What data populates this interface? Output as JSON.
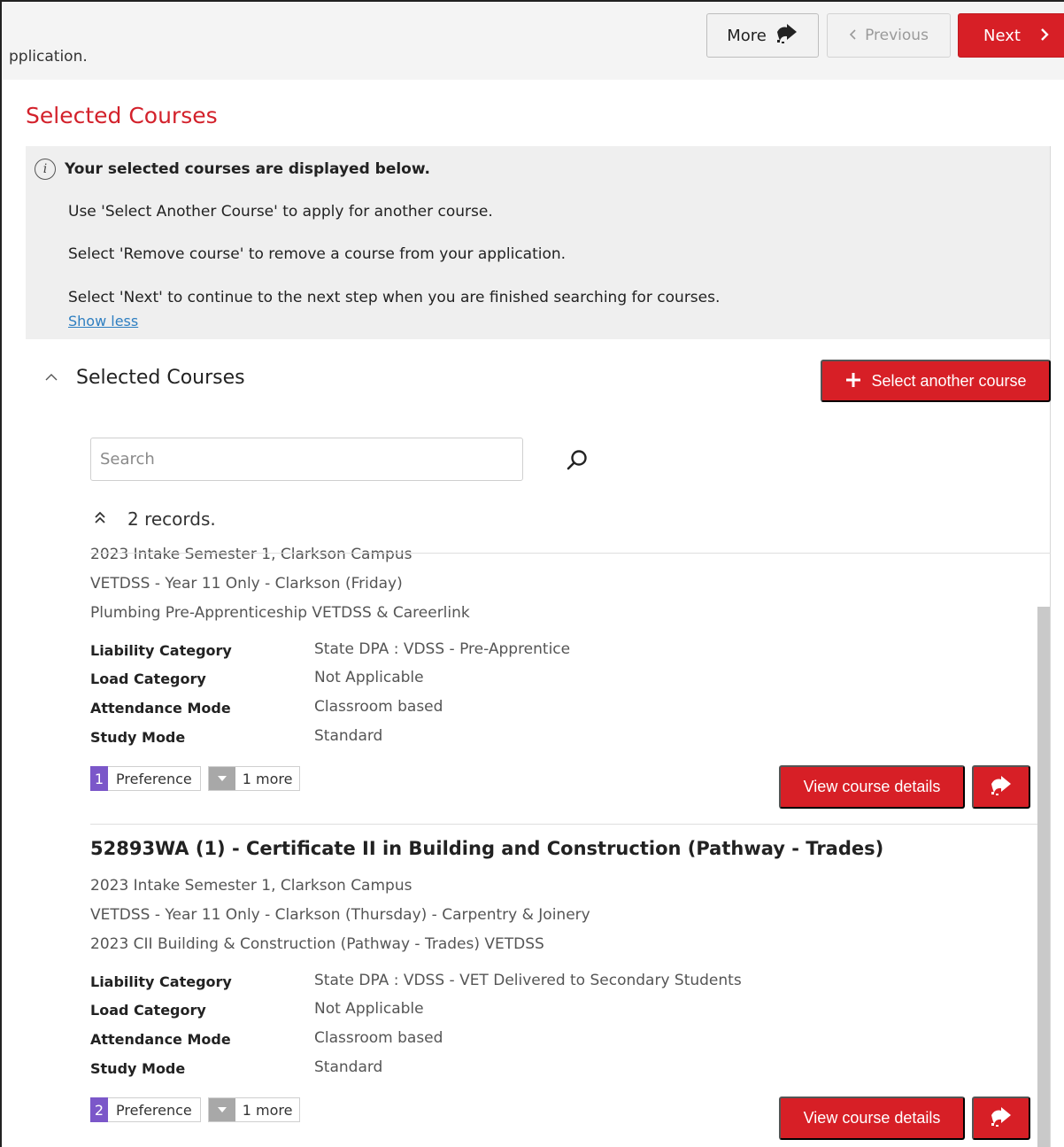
{
  "topbar": {
    "crumb": "pplication.",
    "more_label": "More",
    "prev_label": "Previous",
    "next_label": "Next"
  },
  "page": {
    "title": "Selected Courses"
  },
  "info": {
    "heading": "Your selected courses are displayed below.",
    "line1": "Use 'Select Another Course' to apply for another course.",
    "line2": "Select 'Remove course' to remove a course from your application.",
    "line3": "Select 'Next' to continue to the next step when you are finished searching for courses.",
    "toggle": "Show less"
  },
  "section": {
    "title": "Selected Courses",
    "add_label": "Select another course",
    "search_placeholder": "Search",
    "records": "2 records."
  },
  "labels": {
    "liability": "Liability Category",
    "load": "Load Category",
    "attendance": "Attendance Mode",
    "study": "Study Mode",
    "preference": "Preference",
    "more": "1 more",
    "view": "View course details"
  },
  "courses": [
    {
      "title": "",
      "intake": "2023 Intake Semester 1, Clarkson Campus",
      "group": "VETDSS - Year 11 Only - Clarkson (Friday)",
      "offering": "Plumbing Pre-Apprenticeship VETDSS & Careerlink",
      "liability": "State DPA : VDSS - Pre-Apprentice",
      "load": "Not Applicable",
      "attendance": "Classroom based",
      "study": "Standard",
      "pref_num": "1"
    },
    {
      "title": "52893WA (1) - Certificate II in Building and Construction (Pathway - Trades)",
      "intake": "2023 Intake Semester 1, Clarkson Campus",
      "group": "VETDSS - Year 11 Only - Clarkson (Thursday) - Carpentry & Joinery",
      "offering": "2023 CII Building & Construction (Pathway - Trades) VETDSS",
      "liability": "State DPA : VDSS - VET Delivered to Secondary Students",
      "load": "Not Applicable",
      "attendance": "Classroom based",
      "study": "Standard",
      "pref_num": "2"
    }
  ],
  "colors": {
    "accent": "#d71f26",
    "title": "#d3212b",
    "preference": "#7b57c9",
    "link": "#2f7fc1"
  },
  "icons": [
    "info-icon",
    "go-arrow-icon",
    "chevron-left-icon",
    "chevron-right-icon",
    "plus-icon",
    "search-icon",
    "chevron-up-icon",
    "double-chevron-up-icon",
    "chevron-down-icon"
  ]
}
